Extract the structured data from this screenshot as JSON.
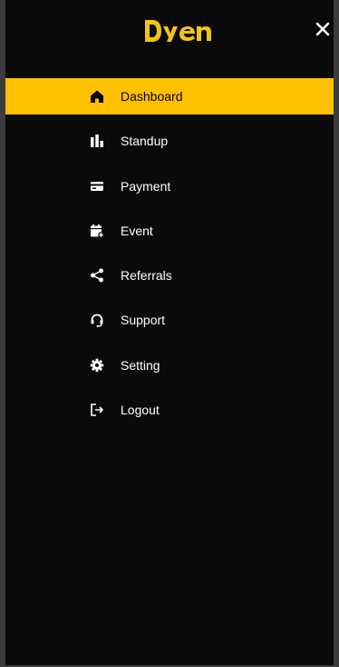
{
  "logo": {
    "text": "Dyen",
    "color": "#f5c218"
  },
  "colors": {
    "background": "#0a0a0a",
    "active_background": "#ffc000",
    "active_text": "#000000",
    "text": "#ffffff"
  },
  "close_icon": "close-icon",
  "menu": {
    "items": [
      {
        "label": "Dashboard",
        "icon": "home-icon",
        "active": true
      },
      {
        "label": "Standup",
        "icon": "bar-chart-icon",
        "active": false
      },
      {
        "label": "Payment",
        "icon": "credit-card-icon",
        "active": false
      },
      {
        "label": "Event",
        "icon": "calendar-add-icon",
        "active": false
      },
      {
        "label": "Referrals",
        "icon": "share-icon",
        "active": false
      },
      {
        "label": "Support",
        "icon": "headset-icon",
        "active": false
      },
      {
        "label": "Setting",
        "icon": "gear-icon",
        "active": false
      },
      {
        "label": "Logout",
        "icon": "logout-icon",
        "active": false
      }
    ]
  }
}
